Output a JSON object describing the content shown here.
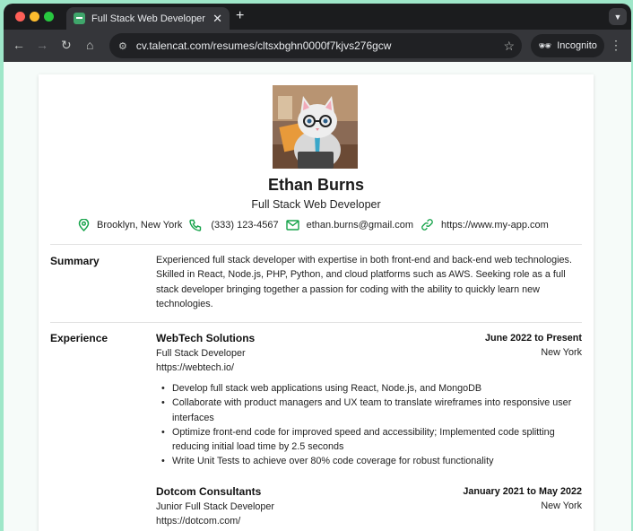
{
  "browser": {
    "tab_title": "Full Stack Web Developer | Ta",
    "tab_close": "✕",
    "new_tab": "+",
    "url": "cv.talencat.com/resumes/cltsxbghn0000f7kjvs276gcw",
    "incognito_label": "Incognito",
    "icons": [
      "back-icon",
      "forward-icon",
      "reload-icon",
      "home-icon",
      "site-info-icon",
      "star-icon",
      "incognito-icon",
      "menu-icon",
      "tab-search-icon"
    ]
  },
  "resume": {
    "name": "Ethan Burns",
    "title": "Full Stack Web Developer",
    "contact": {
      "location": "Brooklyn, New York",
      "phone": "(333) 123-4567",
      "email": "ethan.burns@gmail.com",
      "website": "https://www.my-app.com"
    },
    "summary_label": "Summary",
    "summary": "Experienced full stack developer with expertise in both front-end and back-end web technologies. Skilled in React, Node.js, PHP, Python, and cloud platforms such as AWS. Seeking role as a full stack developer bringing together a passion for coding with the ability to quickly learn new technologies.",
    "experience_label": "Experience",
    "experience": [
      {
        "company": "WebTech Solutions",
        "dates": "June 2022 to Present",
        "location": "New York",
        "role": "Full Stack Developer",
        "url": "https://webtech.io/",
        "bullets": [
          "Develop full stack web applications using React, Node.js, and MongoDB",
          "Collaborate with product managers and UX team to translate wireframes into responsive user interfaces",
          "Optimize front-end code for improved speed and accessibility; Implemented code splitting reducing initial load time by 2.5 seconds",
          "Write Unit Tests to achieve over 80% code coverage for robust functionality"
        ]
      },
      {
        "company": "Dotcom Consultants",
        "dates": "January 2021 to May 2022",
        "location": "New York",
        "role": "Junior Full Stack Developer",
        "url": "https://dotcom.com/"
      }
    ]
  },
  "colors": {
    "accent": "#16a34a",
    "browser_frame": "#35363a",
    "page_background": "#9fe7c9"
  }
}
